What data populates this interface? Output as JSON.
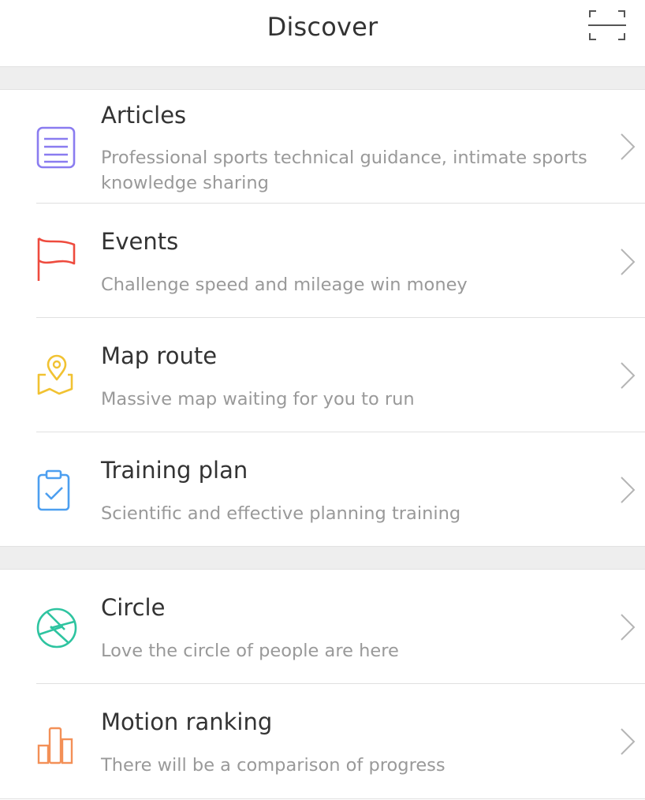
{
  "header": {
    "title": "Discover",
    "scan_icon": "scan-icon"
  },
  "sections": [
    {
      "items": [
        {
          "id": "articles",
          "icon": "article-list-icon",
          "icon_color": "#8a7cf0",
          "title": "Articles",
          "description": "Professional sports technical guidance, intimate sports knowledge sharing"
        },
        {
          "id": "events",
          "icon": "flag-icon",
          "icon_color": "#ee4b3e",
          "title": "Events",
          "description": "Challenge speed and mileage win money"
        },
        {
          "id": "map-route",
          "icon": "map-pin-icon",
          "icon_color": "#f1c232",
          "title": "Map route",
          "description": "Massive map waiting for you to run"
        },
        {
          "id": "training-plan",
          "icon": "clipboard-check-icon",
          "icon_color": "#4d9ff0",
          "title": "Training plan",
          "description": "Scientific and effective planning training"
        }
      ]
    },
    {
      "items": [
        {
          "id": "circle",
          "icon": "aperture-icon",
          "icon_color": "#2ec4a0",
          "title": "Circle",
          "description": "Love the circle of people are here"
        },
        {
          "id": "motion-ranking",
          "icon": "bar-chart-icon",
          "icon_color": "#f39057",
          "title": "Motion ranking",
          "description": "There will be a comparison of progress"
        }
      ]
    }
  ],
  "colors": {
    "background": "#ffffff",
    "section_band": "#eeeeee",
    "title_text": "#333333",
    "description_text": "#999999",
    "chevron": "#b5b5b5"
  }
}
